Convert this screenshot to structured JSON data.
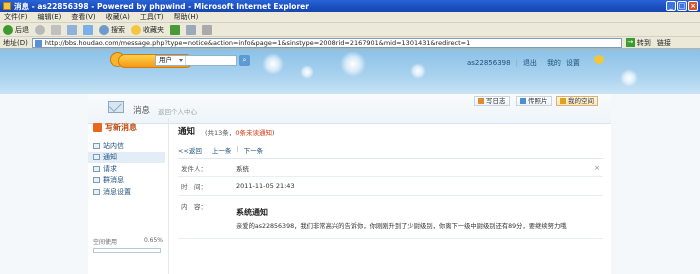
{
  "window": {
    "title": "消息 - as22856398 - Powered by phpwind - Microsoft Internet Explorer",
    "minimize_glyph": "_",
    "maximize_glyph": "□",
    "close_glyph": "×"
  },
  "menu": [
    "文件(F)",
    "编辑(E)",
    "查看(V)",
    "收藏(A)",
    "工具(T)",
    "帮助(H)"
  ],
  "toolbar": {
    "back": "后退",
    "search": "搜索",
    "favorites": "收藏夹"
  },
  "address": {
    "label": "地址(D)",
    "url": "http://bbs.houdao.com/message.php?type=notice&action=info&page=1&sinstype=2008rid=2167901&mid=1301431&redirect=1",
    "go": "转到",
    "links": "链接"
  },
  "header": {
    "search_type": "用户",
    "username": "as22856398",
    "logout": "退出",
    "messages": "我的",
    "settings": "设置"
  },
  "msgbar": {
    "title": "消息",
    "subtitle": "返回个人中心",
    "buttons": [
      "写日志",
      "传照片",
      "我的空间"
    ]
  },
  "sidebar": {
    "compose": "写新消息",
    "items": [
      "站内信",
      "通知",
      "请求",
      "群消息",
      "消息设置"
    ],
    "active_index": 1,
    "space_label": "空间使用",
    "space_percent": "0.65%"
  },
  "main": {
    "title": "通知",
    "count_prefix": "(共13条，",
    "count_unread": "0条未读通知",
    "count_suffix": ")",
    "back": "<<返回",
    "prev": "上一条",
    "next": "下一条",
    "sender_label": "发件人：",
    "sender_value": "系统",
    "time_label": "时　间：",
    "time_value": "2011-11-05 21:43",
    "content_label": "内　容：",
    "content_title": "系统通知",
    "content_body": "亲爱的as22856398，我们非常高兴的告诉你，你刚刚升到了少尉级别，你离下一级中尉级别还有89分，要继续努力哦",
    "close": "×"
  }
}
